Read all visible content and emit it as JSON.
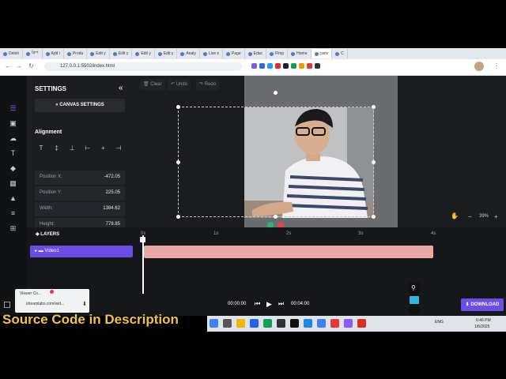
{
  "browser": {
    "tabs": [
      "Deleti",
      "ক্লিপ",
      "Add i",
      "Produ",
      "Edit y",
      "Edit y",
      "Edit y",
      "Edit y",
      "Analy",
      "Live s",
      "Page",
      "Educ",
      "Flmp",
      "Home",
      "canv",
      "C"
    ],
    "address": "127.0.0.1:5502/index.html",
    "extension_colors": [
      "#7c5cf0",
      "#2d6cdf",
      "#1da1f2",
      "#d93025",
      "#222222",
      "#0f9d58",
      "#f29900",
      "#e53935",
      "#333333"
    ]
  },
  "sidebar": {
    "icons": [
      "settings-sliders-icon",
      "media-icon",
      "upload-cloud-icon",
      "text-icon",
      "shapes-icon",
      "grid-icon",
      "shape-icon",
      "subtitles-icon",
      "apps-icon"
    ],
    "title": "SETTINGS",
    "collapse_icon": "«",
    "canvas_settings": "« CANVAS SETTINGS",
    "alignment_title": "Alignment",
    "align_buttons": [
      "T",
      "‡",
      "⊥",
      "⊢",
      "+",
      "⊣"
    ],
    "properties": [
      {
        "label": "Position X:",
        "value": "-472.05"
      },
      {
        "label": "Position Y:",
        "value": "225.05"
      },
      {
        "label": "Width:",
        "value": "1384.62"
      },
      {
        "label": "Height:",
        "value": "778.85"
      }
    ]
  },
  "toolbar": {
    "clear": "Clear",
    "undo": "Undo",
    "redo": "Redo"
  },
  "canvas": {
    "zoom": "39%",
    "zoom_minus": "−",
    "zoom_plus": "+"
  },
  "timeline": {
    "layers_title": "LAYERS",
    "layer_name": "Video1",
    "ticks": [
      "0s",
      "1s",
      "2s",
      "3s",
      "4s"
    ],
    "current_time": "00:00:00",
    "total_time": "00:04:00",
    "download": "DOWNLOAD"
  },
  "notification": {
    "title": "Viewer Co...",
    "url": "streamlabs.com/wid..."
  },
  "taskbar": {
    "lang": "ENG",
    "time": "6:46 PM",
    "date": "1/6/2025"
  },
  "caption": "Source Code in  Description",
  "colors": {
    "accent": "#6b4de6",
    "clip": "#e8a9a5",
    "caption": "#f5c242"
  }
}
